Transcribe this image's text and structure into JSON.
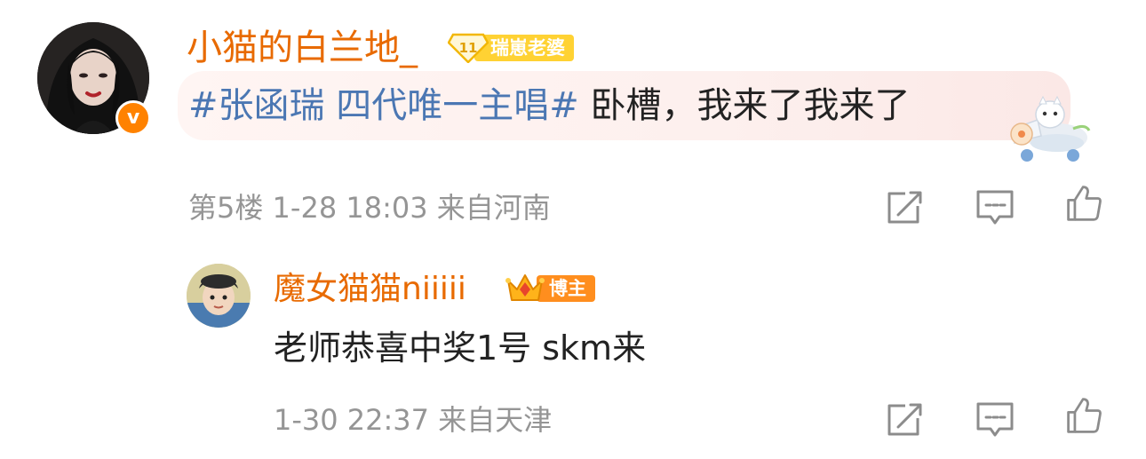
{
  "comment": {
    "username": "小猫的白兰地_",
    "level": "11",
    "fan_badge": "瑞崽老婆",
    "verified_mark": "v",
    "topic": "#张函瑞 四代唯一主唱#",
    "text": " 卧槽，我来了我来了",
    "floor": "第5楼",
    "datetime": "1-28 18:03",
    "location": "来自河南"
  },
  "reply": {
    "username": "魔女猫猫niiiii",
    "badge": "博主",
    "text": "老师恭喜中奖1号 skm来",
    "datetime": "1-30 22:37",
    "location": "来自天津"
  },
  "icons": {
    "share": "share-icon",
    "comment": "comment-icon",
    "like": "like-icon"
  },
  "colors": {
    "username": "#e86a00",
    "topic": "#4b77b3",
    "meta": "#959595",
    "verified": "#ff8200",
    "bubble": "#fdf0ee"
  }
}
